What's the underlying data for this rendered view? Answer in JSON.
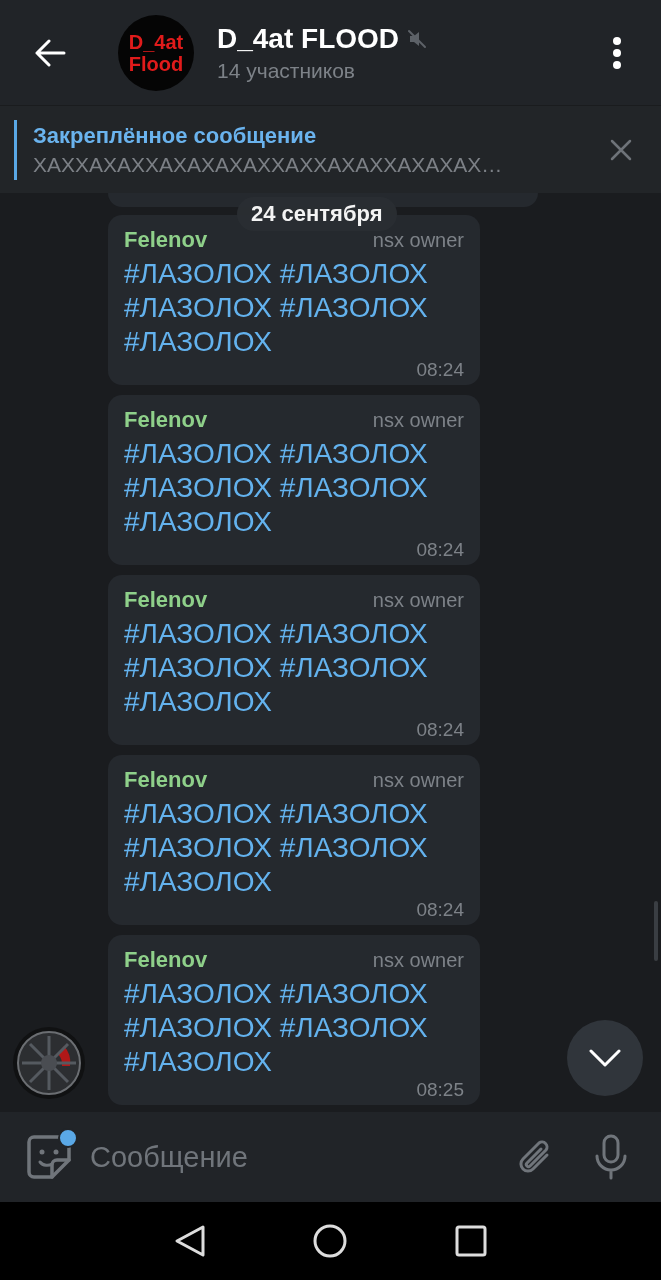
{
  "header": {
    "avatar_lines": [
      "D_4at",
      "Flood"
    ],
    "title": "D_4at FLOOD",
    "muted": true,
    "subtitle": "14 участников"
  },
  "pinned": {
    "title": "Закреплённое сообщение",
    "text": "ХАХХАХАХХАХАХАХАХХАХХАХАХХАХАХАХ…"
  },
  "date_pill": "24 сентября",
  "messages": [
    {
      "sender": "Felenov",
      "badge": "nsx owner",
      "text": "#ЛАЗОЛОХ #ЛАЗОЛОХ #ЛАЗОЛОХ #ЛАЗОЛОХ #ЛАЗОЛОХ",
      "time": "08:24"
    },
    {
      "sender": "Felenov",
      "badge": "nsx owner",
      "text": "#ЛАЗОЛОХ #ЛАЗОЛОХ #ЛАЗОЛОХ #ЛАЗОЛОХ #ЛАЗОЛОХ",
      "time": "08:24"
    },
    {
      "sender": "Felenov",
      "badge": "nsx owner",
      "text": "#ЛАЗОЛОХ #ЛАЗОЛОХ #ЛАЗОЛОХ #ЛАЗОЛОХ #ЛАЗОЛОХ",
      "time": "08:24"
    },
    {
      "sender": "Felenov",
      "badge": "nsx owner",
      "text": "#ЛАЗОЛОХ #ЛАЗОЛОХ #ЛАЗОЛОХ #ЛАЗОЛОХ #ЛАЗОЛОХ",
      "time": "08:24"
    },
    {
      "sender": "Felenov",
      "badge": "nsx owner",
      "text": "#ЛАЗОЛОХ #ЛАЗОЛОХ #ЛАЗОЛОХ #ЛАЗОЛОХ #ЛАЗОЛОХ",
      "time": "08:25"
    }
  ],
  "composer": {
    "placeholder": "Сообщение",
    "sticker_notification": true
  }
}
